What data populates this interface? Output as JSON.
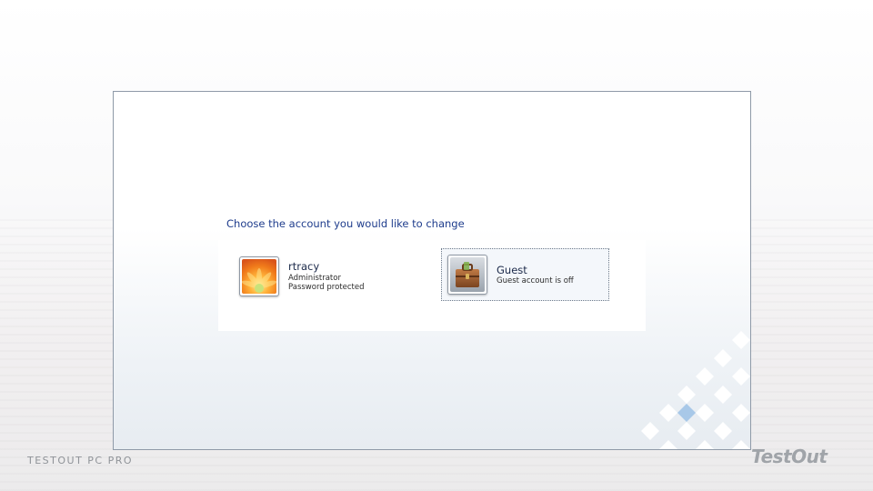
{
  "heading": "Choose the account you would like to change",
  "accounts": [
    {
      "name": "rtracy",
      "line1": "Administrator",
      "line2": "Password protected",
      "icon": "flower-icon"
    },
    {
      "name": "Guest",
      "line1": "Guest account is off",
      "icon": "briefcase-icon",
      "selected": true
    }
  ],
  "footer": {
    "left_text": "TESTOUT PC PRO",
    "logo": "TestOut"
  },
  "colors": {
    "heading": "#1e3c8c",
    "frame_border": "#8f9aa8",
    "accent_diamond": "#a8c8e8"
  }
}
